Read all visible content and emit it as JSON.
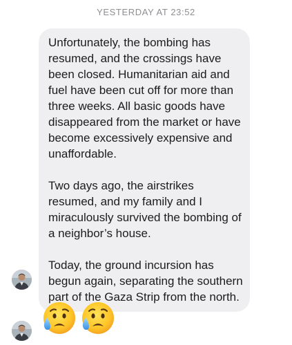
{
  "conversation": {
    "timestamp": "YESTERDAY AT 23:52",
    "message": {
      "paragraphs": [
        "Unfortunately, the bombing has resumed, and the crossings have been closed. Humanitarian aid and fuel have been cut off for more than three weeks. All basic goods have disappeared from the market or have become excessively expensive and unaffordable.",
        "Two days ago, the airstrikes resumed, and my family and I miraculously survived the bombing of a neighbor’s house.",
        "Today, the ground incursion has begun again, separating the southern part of the Gaza Strip from the north."
      ]
    },
    "reactions": [
      {
        "icon": "sad-but-relieved-face-emoji"
      },
      {
        "icon": "sad-but-relieved-face-emoji"
      }
    ],
    "avatar_icon": "contact-avatar-photo"
  }
}
